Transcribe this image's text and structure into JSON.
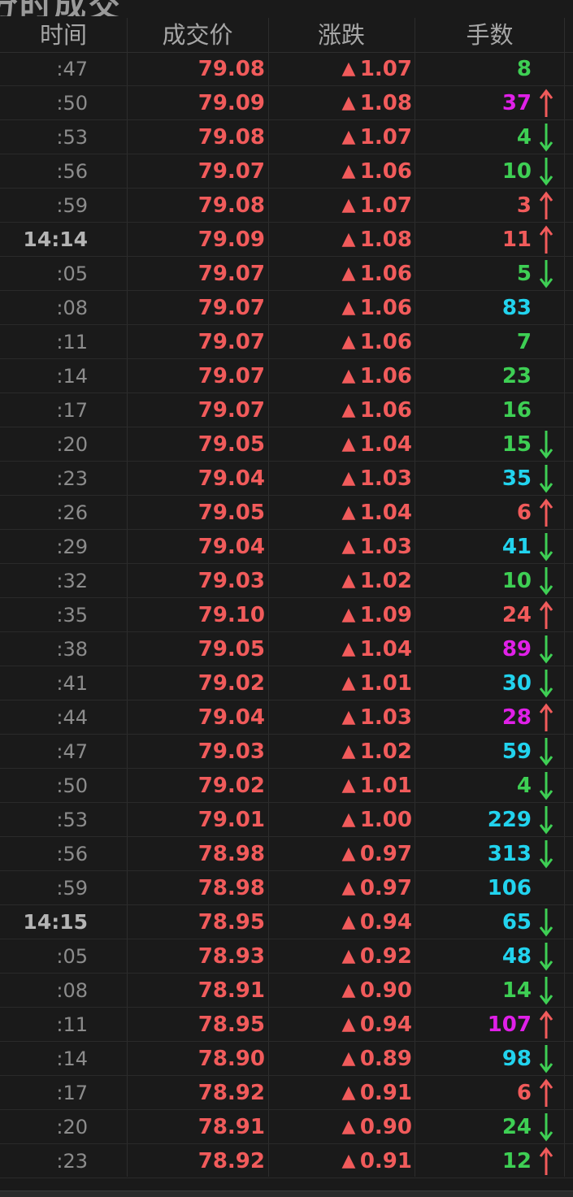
{
  "title": "分时成交",
  "header": {
    "time": "时间",
    "price": "成交价",
    "change": "涨跌",
    "volume": "手数"
  },
  "colors": {
    "up": "#f15b5b",
    "down": "#3ecf54",
    "cyan": "#22d3ee",
    "magenta": "#e020e8",
    "neutral": "#8c8c8c"
  },
  "rows": [
    {
      "time": ":47",
      "price": "79.08",
      "tri": "▲",
      "change": "1.07",
      "volume": "8",
      "vc": "green",
      "arrow": ""
    },
    {
      "time": ":50",
      "price": "79.09",
      "tri": "▲",
      "change": "1.08",
      "volume": "37",
      "vc": "magenta",
      "arrow": "up"
    },
    {
      "time": ":53",
      "price": "79.08",
      "tri": "▲",
      "change": "1.07",
      "volume": "4",
      "vc": "green",
      "arrow": "down"
    },
    {
      "time": ":56",
      "price": "79.07",
      "tri": "▲",
      "change": "1.06",
      "volume": "10",
      "vc": "green",
      "arrow": "down"
    },
    {
      "time": ":59",
      "price": "79.08",
      "tri": "▲",
      "change": "1.07",
      "volume": "3",
      "vc": "red",
      "arrow": "up"
    },
    {
      "time": "14:14",
      "price": "79.09",
      "tri": "▲",
      "change": "1.08",
      "volume": "11",
      "vc": "red",
      "arrow": "up",
      "major": true
    },
    {
      "time": ":05",
      "price": "79.07",
      "tri": "▲",
      "change": "1.06",
      "volume": "5",
      "vc": "green",
      "arrow": "down"
    },
    {
      "time": ":08",
      "price": "79.07",
      "tri": "▲",
      "change": "1.06",
      "volume": "83",
      "vc": "cyan",
      "arrow": ""
    },
    {
      "time": ":11",
      "price": "79.07",
      "tri": "▲",
      "change": "1.06",
      "volume": "7",
      "vc": "green",
      "arrow": ""
    },
    {
      "time": ":14",
      "price": "79.07",
      "tri": "▲",
      "change": "1.06",
      "volume": "23",
      "vc": "green",
      "arrow": ""
    },
    {
      "time": ":17",
      "price": "79.07",
      "tri": "▲",
      "change": "1.06",
      "volume": "16",
      "vc": "green",
      "arrow": ""
    },
    {
      "time": ":20",
      "price": "79.05",
      "tri": "▲",
      "change": "1.04",
      "volume": "15",
      "vc": "green",
      "arrow": "down"
    },
    {
      "time": ":23",
      "price": "79.04",
      "tri": "▲",
      "change": "1.03",
      "volume": "35",
      "vc": "cyan",
      "arrow": "down"
    },
    {
      "time": ":26",
      "price": "79.05",
      "tri": "▲",
      "change": "1.04",
      "volume": "6",
      "vc": "red",
      "arrow": "up"
    },
    {
      "time": ":29",
      "price": "79.04",
      "tri": "▲",
      "change": "1.03",
      "volume": "41",
      "vc": "cyan",
      "arrow": "down"
    },
    {
      "time": ":32",
      "price": "79.03",
      "tri": "▲",
      "change": "1.02",
      "volume": "10",
      "vc": "green",
      "arrow": "down"
    },
    {
      "time": ":35",
      "price": "79.10",
      "tri": "▲",
      "change": "1.09",
      "volume": "24",
      "vc": "red",
      "arrow": "up"
    },
    {
      "time": ":38",
      "price": "79.05",
      "tri": "▲",
      "change": "1.04",
      "volume": "89",
      "vc": "magenta",
      "arrow": "down"
    },
    {
      "time": ":41",
      "price": "79.02",
      "tri": "▲",
      "change": "1.01",
      "volume": "30",
      "vc": "cyan",
      "arrow": "down"
    },
    {
      "time": ":44",
      "price": "79.04",
      "tri": "▲",
      "change": "1.03",
      "volume": "28",
      "vc": "magenta",
      "arrow": "up"
    },
    {
      "time": ":47",
      "price": "79.03",
      "tri": "▲",
      "change": "1.02",
      "volume": "59",
      "vc": "cyan",
      "arrow": "down"
    },
    {
      "time": ":50",
      "price": "79.02",
      "tri": "▲",
      "change": "1.01",
      "volume": "4",
      "vc": "green",
      "arrow": "down"
    },
    {
      "time": ":53",
      "price": "79.01",
      "tri": "▲",
      "change": "1.00",
      "volume": "229",
      "vc": "cyan",
      "arrow": "down"
    },
    {
      "time": ":56",
      "price": "78.98",
      "tri": "▲",
      "change": "0.97",
      "volume": "313",
      "vc": "cyan",
      "arrow": "down"
    },
    {
      "time": ":59",
      "price": "78.98",
      "tri": "▲",
      "change": "0.97",
      "volume": "106",
      "vc": "cyan",
      "arrow": ""
    },
    {
      "time": "14:15",
      "price": "78.95",
      "tri": "▲",
      "change": "0.94",
      "volume": "65",
      "vc": "cyan",
      "arrow": "down",
      "major": true
    },
    {
      "time": ":05",
      "price": "78.93",
      "tri": "▲",
      "change": "0.92",
      "volume": "48",
      "vc": "cyan",
      "arrow": "down"
    },
    {
      "time": ":08",
      "price": "78.91",
      "tri": "▲",
      "change": "0.90",
      "volume": "14",
      "vc": "green",
      "arrow": "down"
    },
    {
      "time": ":11",
      "price": "78.95",
      "tri": "▲",
      "change": "0.94",
      "volume": "107",
      "vc": "magenta",
      "arrow": "up"
    },
    {
      "time": ":14",
      "price": "78.90",
      "tri": "▲",
      "change": "0.89",
      "volume": "98",
      "vc": "cyan",
      "arrow": "down"
    },
    {
      "time": ":17",
      "price": "78.92",
      "tri": "▲",
      "change": "0.91",
      "volume": "6",
      "vc": "red",
      "arrow": "up"
    },
    {
      "time": ":20",
      "price": "78.91",
      "tri": "▲",
      "change": "0.90",
      "volume": "24",
      "vc": "green",
      "arrow": "down"
    },
    {
      "time": ":23",
      "price": "78.92",
      "tri": "▲",
      "change": "0.91",
      "volume": "12",
      "vc": "green",
      "arrow": "up"
    }
  ]
}
